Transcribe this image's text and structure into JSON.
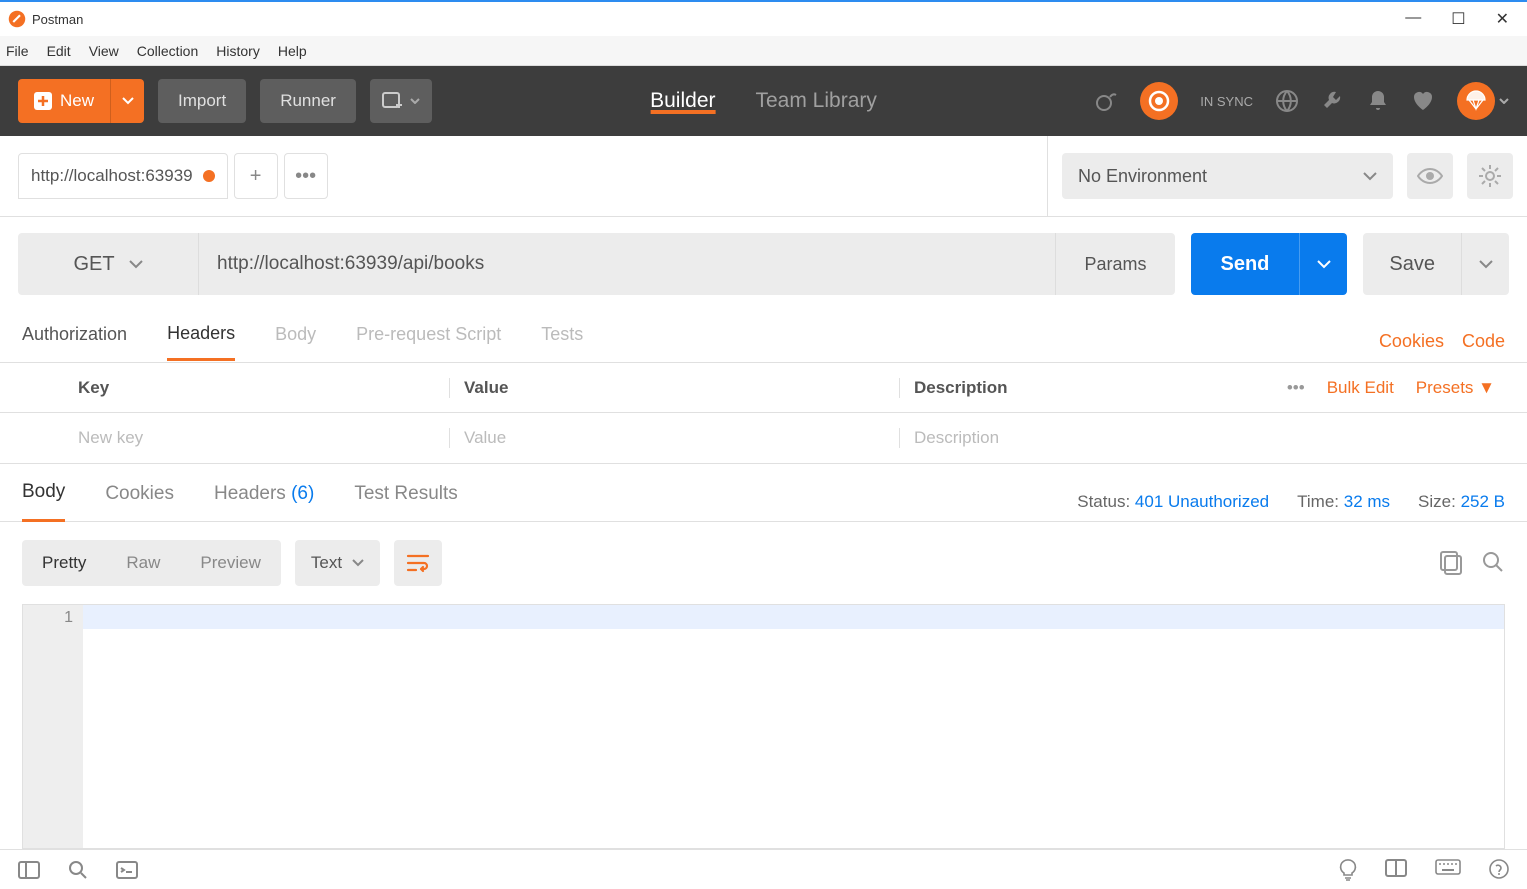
{
  "window": {
    "title": "Postman"
  },
  "menubar": [
    "File",
    "Edit",
    "View",
    "Collection",
    "History",
    "Help"
  ],
  "header": {
    "new_label": "New",
    "import_label": "Import",
    "runner_label": "Runner",
    "tabs": {
      "builder": "Builder",
      "team_library": "Team Library"
    },
    "sync_label": "IN SYNC"
  },
  "tabs": {
    "active_title": "http://localhost:63939",
    "env_selected": "No Environment"
  },
  "request": {
    "method": "GET",
    "url": "http://localhost:63939/api/books",
    "params_label": "Params",
    "send_label": "Send",
    "save_label": "Save",
    "subtabs": [
      "Authorization",
      "Headers",
      "Body",
      "Pre-request Script",
      "Tests"
    ],
    "cookies_link": "Cookies",
    "code_link": "Code",
    "headers_table": {
      "cols": {
        "key": "Key",
        "value": "Value",
        "desc": "Description"
      },
      "placeholders": {
        "key": "New key",
        "value": "Value",
        "desc": "Description"
      },
      "bulk_edit": "Bulk Edit",
      "presets": "Presets"
    }
  },
  "response": {
    "tabs": {
      "body": "Body",
      "cookies": "Cookies",
      "headers": "Headers",
      "headers_count": "(6)",
      "tests": "Test Results"
    },
    "status_label": "Status:",
    "status_value": "401 Unauthorized",
    "time_label": "Time:",
    "time_value": "32 ms",
    "size_label": "Size:",
    "size_value": "252 B",
    "view": {
      "pretty": "Pretty",
      "raw": "Raw",
      "preview": "Preview",
      "format": "Text"
    },
    "line_number": "1"
  }
}
